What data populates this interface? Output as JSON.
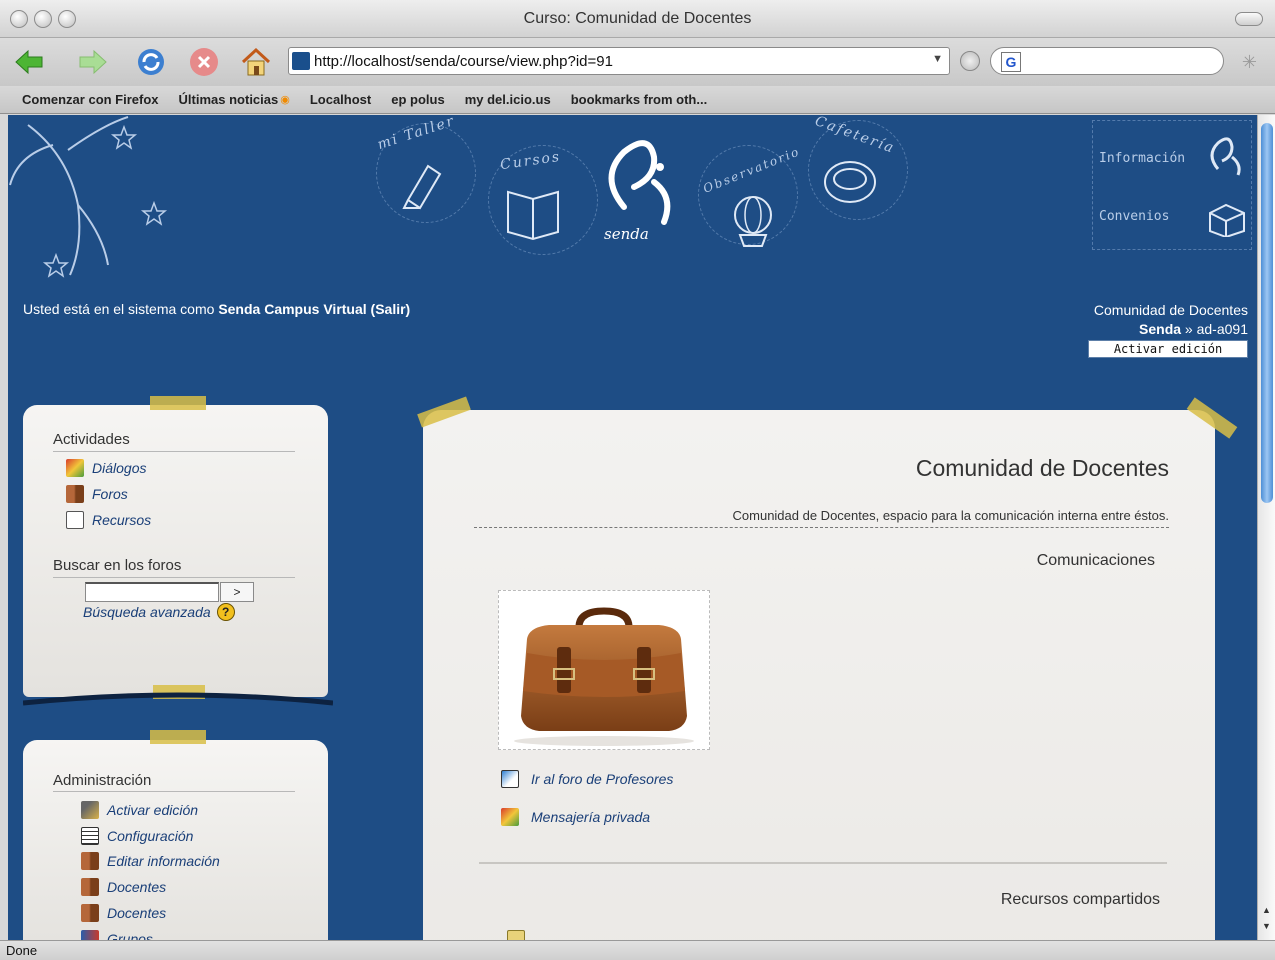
{
  "window": {
    "title": "Curso: Comunidad de Docentes"
  },
  "toolbar": {
    "url": "http://localhost/senda/course/view.php?id=91"
  },
  "bookmarks": [
    "Comenzar con Firefox",
    "Últimas noticias",
    "Localhost",
    "ep polus",
    "my del.icio.us",
    "bookmarks from oth..."
  ],
  "header": {
    "nav": [
      "mi Taller",
      "Cursos",
      "Observatorio",
      "Cafetería"
    ],
    "logo_text": "senda",
    "links": [
      "Información",
      "Convenios"
    ]
  },
  "login": {
    "prefix": "Usted está en el sistema como",
    "user": "Senda Campus Virtual",
    "logout": "(Salir)"
  },
  "breadcrumb": {
    "course": "Comunidad de Docentes",
    "root": "Senda",
    "sep": "»",
    "current": "ad-a091"
  },
  "edit_button": "Activar edición",
  "activities": {
    "title": "Actividades",
    "items": [
      "Diálogos",
      "Foros",
      "Recursos"
    ]
  },
  "forum_search": {
    "title": "Buscar en los foros",
    "button": ">",
    "advanced": "Búsqueda avanzada",
    "help": "?"
  },
  "admin": {
    "title": "Administración",
    "items": [
      "Activar edición",
      "Configuración",
      "Editar información",
      "Docentes",
      "Docentes",
      "Grupos"
    ]
  },
  "course": {
    "title": "Comunidad de Docentes",
    "description": "Comunidad de Docentes, espacio para la comunicación interna entre éstos.",
    "section1": "Comunicaciones",
    "activities": [
      "Ir al foro de Profesores",
      "Mensajería privada"
    ],
    "section2": "Recursos compartidos"
  },
  "status": "Done",
  "colors": {
    "page_bg": "#1e4d85",
    "link": "#1a3f78",
    "tape": "#d8be46"
  }
}
